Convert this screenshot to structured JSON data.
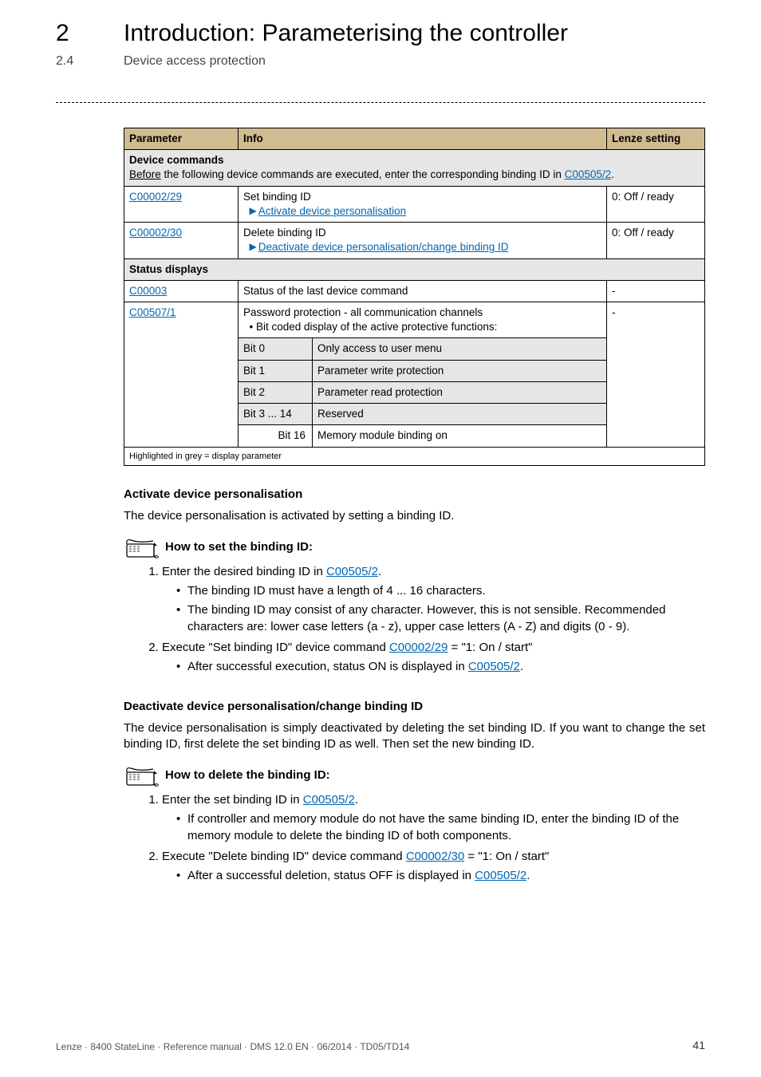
{
  "header": {
    "chapter_num": "2",
    "chapter_title": "Introduction: Parameterising the controller",
    "section_num": "2.4",
    "section_title": "Device access protection"
  },
  "table": {
    "head": {
      "parameter": "Parameter",
      "info": "Info",
      "lenze": "Lenze setting"
    },
    "device_commands_label": "Device commands",
    "device_commands_note_pre": "Before",
    "device_commands_note_mid": " the following device commands are executed, enter the corresponding binding ID in ",
    "device_commands_note_link": "C00505/2",
    "device_commands_note_post": ".",
    "row1": {
      "code": "C00002/29",
      "info_line1": "Set binding ID",
      "info_link": "Activate device personalisation",
      "lenze": "0: Off / ready"
    },
    "row2": {
      "code": "C00002/30",
      "info_line1": "Delete binding ID",
      "info_link": "Deactivate device personalisation/change binding ID",
      "lenze": "0: Off / ready"
    },
    "status_label": "Status displays",
    "row3": {
      "code": "C00003",
      "info": "Status of the last device command",
      "lenze": "-"
    },
    "row4": {
      "code": "C00507/1",
      "info_line1": "Password protection - all communication channels",
      "info_line2": "• Bit coded display of the active protective functions:",
      "lenze": "-"
    },
    "bits": {
      "b0k": "Bit 0",
      "b0v": "Only access to user menu",
      "b1k": "Bit 1",
      "b1v": "Parameter write protection",
      "b2k": "Bit 2",
      "b2v": "Parameter read protection",
      "b3k": "Bit 3 ... 14",
      "b3v": "Reserved",
      "b16k": "Bit 16",
      "b16v": "Memory module binding on"
    },
    "foot": "Highlighted in grey = display parameter"
  },
  "sec_a": {
    "heading": "Activate device personalisation",
    "intro": "The device personalisation is activated by setting a binding ID.",
    "howto": "How to set the binding ID:",
    "step1_pre": "Enter the desired binding ID in ",
    "step1_link": "C00505/2",
    "step1_post": ".",
    "step1_sub1": "The binding ID must have a length of 4 ... 16 characters.",
    "step1_sub2": "The binding ID may consist of any character. However, this is not sensible. Recommended characters are: lower case letters (a - z), upper case letters (A - Z) and digits (0 - 9).",
    "step2_pre": "Execute \"Set binding ID\" device command ",
    "step2_link": "C00002/29",
    "step2_post": "  = \"1: On / start\"",
    "step2_sub_pre": "After successful execution, status ON is displayed in ",
    "step2_sub_link": "C00505/2",
    "step2_sub_post": "."
  },
  "sec_b": {
    "heading": "Deactivate device personalisation/change binding ID",
    "intro": "The device personalisation is simply deactivated by deleting the set binding ID. If you want to change the set binding ID, first delete the set binding ID as well. Then set the new binding ID.",
    "howto": "How to delete the binding ID:",
    "step1_pre": "Enter the set binding ID in ",
    "step1_link": "C00505/2",
    "step1_post": ".",
    "step1_sub1": "If controller and memory module do not have the same binding ID, enter the binding ID of the memory module to delete the binding ID of both components.",
    "step2_pre": "Execute \"Delete binding ID\" device command ",
    "step2_link": "C00002/30",
    "step2_post": "  = \"1: On / start\"",
    "step2_sub_pre": "After a successful deletion, status OFF is displayed in ",
    "step2_sub_link": "C00505/2",
    "step2_sub_post": "."
  },
  "footer": {
    "text": "Lenze · 8400 StateLine · Reference manual · DMS 12.0 EN · 06/2014 · TD05/TD14",
    "page": "41"
  }
}
